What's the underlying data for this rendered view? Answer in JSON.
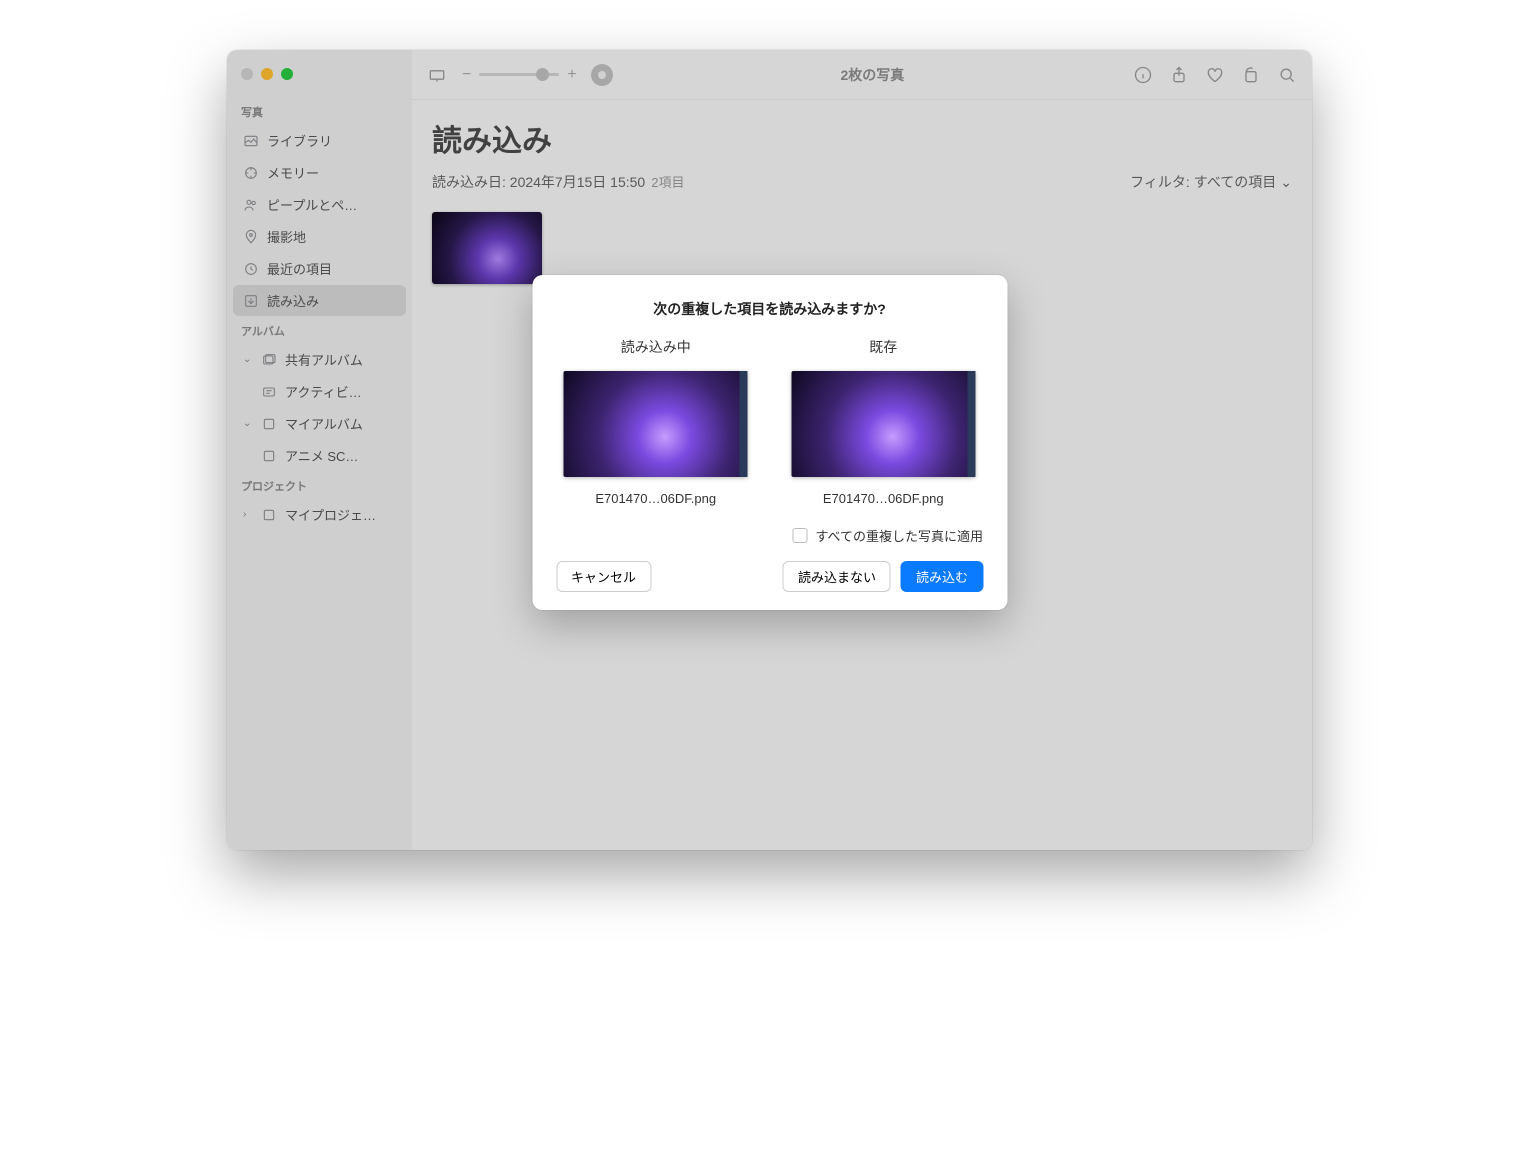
{
  "toolbar": {
    "title": "2枚の写真"
  },
  "sidebar": {
    "section_photos": "写真",
    "items_photos": [
      {
        "label": "ライブラリ",
        "icon": "library"
      },
      {
        "label": "メモリー",
        "icon": "memories"
      },
      {
        "label": "ピープルとペ…",
        "icon": "people"
      },
      {
        "label": "撮影地",
        "icon": "places"
      },
      {
        "label": "最近の項目",
        "icon": "recent"
      },
      {
        "label": "読み込み",
        "icon": "import"
      }
    ],
    "section_albums": "アルバム",
    "shared_albums": "共有アルバム",
    "activity": "アクティビ…",
    "my_albums": "マイアルバム",
    "anime_sc": "アニメ SC…",
    "section_projects": "プロジェクト",
    "my_projects": "マイプロジェ…"
  },
  "page": {
    "title": "読み込み",
    "import_date_label": "読み込み日: 2024年7月15日 15:50",
    "item_count": "2項目",
    "filter_label": "フィルタ:",
    "filter_value": "すべての項目"
  },
  "modal": {
    "title": "次の重複した項目を読み込みますか?",
    "col_importing": "読み込み中",
    "col_existing": "既存",
    "filename_a": "E701470…06DF.png",
    "filename_b": "E701470…06DF.png",
    "apply_all": "すべての重複した写真に適用",
    "cancel": "キャンセル",
    "dont_import": "読み込まない",
    "import": "読み込む"
  }
}
